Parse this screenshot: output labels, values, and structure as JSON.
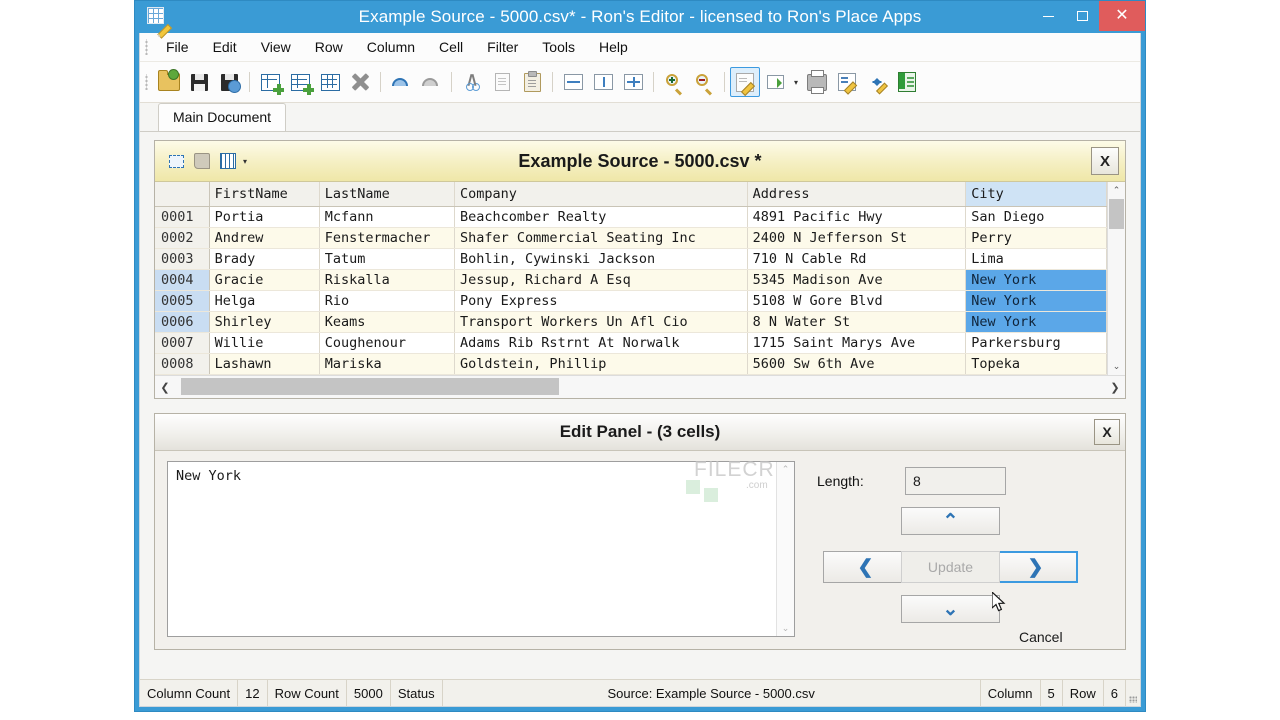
{
  "window": {
    "title": "Example Source - 5000.csv* - Ron's Editor - licensed to Ron's Place Apps",
    "app_icon": "grid-pencil-icon",
    "minimize": "minimize-icon",
    "maximize": "maximize-icon",
    "close": "close-icon",
    "accent": "#3a9bd5",
    "close_color": "#e05c5c"
  },
  "menu": {
    "items": [
      "File",
      "Edit",
      "View",
      "Row",
      "Column",
      "Cell",
      "Filter",
      "Tools",
      "Help"
    ]
  },
  "toolbar": {
    "items": [
      {
        "name": "open-file-icon"
      },
      {
        "name": "save-icon"
      },
      {
        "name": "save-as-icon"
      },
      {
        "name": "insert-column-icon"
      },
      {
        "name": "insert-row-icon"
      },
      {
        "name": "table-icon"
      },
      {
        "name": "delete-icon"
      },
      {
        "name": "undo-icon"
      },
      {
        "name": "redo-icon"
      },
      {
        "name": "cut-icon"
      },
      {
        "name": "copy-icon"
      },
      {
        "name": "paste-icon"
      },
      {
        "name": "fit-width-icon"
      },
      {
        "name": "fit-height-icon"
      },
      {
        "name": "fit-page-icon"
      },
      {
        "name": "zoom-in-icon"
      },
      {
        "name": "zoom-out-icon"
      },
      {
        "name": "edit-document-icon",
        "active": true
      },
      {
        "name": "export-icon",
        "caret": true
      },
      {
        "name": "print-icon"
      },
      {
        "name": "edit-schema-icon"
      },
      {
        "name": "sort-icon"
      },
      {
        "name": "excel-icon"
      }
    ]
  },
  "tabs": [
    {
      "label": "Main Document",
      "active": true
    }
  ],
  "grid_panel": {
    "title": "Example Source - 5000.csv *",
    "close_label": "X",
    "tools": [
      "select-region-icon",
      "stamp-icon",
      "columns-icon"
    ],
    "caret": "▾",
    "columns": [
      "",
      "FirstName",
      "LastName",
      "Company",
      "Address",
      "City"
    ],
    "selected_column": "City",
    "rows": [
      {
        "num": "0001",
        "first": "Portia",
        "last": "Mcfann",
        "company": "Beachcomber Realty",
        "address": "4891 Pacific Hwy",
        "city": "San Diego",
        "city_selected": false,
        "row_highlight": false
      },
      {
        "num": "0002",
        "first": "Andrew",
        "last": "Fenstermacher",
        "company": "Shafer Commercial Seating Inc",
        "address": "2400 N Jefferson St",
        "city": "Perry",
        "city_selected": false,
        "row_highlight": false
      },
      {
        "num": "0003",
        "first": "Brady",
        "last": "Tatum",
        "company": "Bohlin, Cywinski Jackson",
        "address": "710 N Cable Rd",
        "city": "Lima",
        "city_selected": false,
        "row_highlight": false
      },
      {
        "num": "0004",
        "first": "Gracie",
        "last": "Riskalla",
        "company": "Jessup, Richard A Esq",
        "address": "5345 Madison Ave",
        "city": "New York",
        "city_selected": true,
        "row_highlight": true
      },
      {
        "num": "0005",
        "first": "Helga",
        "last": "Rio",
        "company": "Pony Express",
        "address": "5108 W Gore Blvd",
        "city": "New York",
        "city_selected": true,
        "row_highlight": true
      },
      {
        "num": "0006",
        "first": "Shirley",
        "last": "Keams",
        "company": "Transport Workers Un Afl Cio",
        "address": "8 N Water St",
        "city": "New York",
        "city_selected": true,
        "row_highlight": true
      },
      {
        "num": "0007",
        "first": "Willie",
        "last": "Coughenour",
        "company": "Adams Rib Rstrnt At Norwalk",
        "address": "1715 Saint Marys Ave",
        "city": "Parkersburg",
        "city_selected": false,
        "row_highlight": false
      },
      {
        "num": "0008",
        "first": "Lashawn",
        "last": "Mariska",
        "company": "Goldstein, Phillip",
        "address": "5600 Sw 6th Ave",
        "city": "Topeka",
        "city_selected": false,
        "row_highlight": false
      }
    ],
    "selection_color": "#5ba7e8"
  },
  "edit_panel": {
    "title": "Edit Panel - (3 cells)",
    "close_label": "X",
    "value": "New York",
    "length_label": "Length:",
    "length_value": "8",
    "buttons": {
      "up": "▲",
      "down": "▼",
      "prev": "❮",
      "next": "❯",
      "update": "Update",
      "update_disabled": true,
      "cancel": "Cancel"
    }
  },
  "watermark": {
    "big": "FILECR",
    "small": ".com"
  },
  "statusbar": {
    "column_count_label": "Column Count",
    "column_count_value": "12",
    "row_count_label": "Row Count",
    "row_count_value": "5000",
    "status_label": "Status",
    "source": "Source: Example Source - 5000.csv",
    "column_label": "Column",
    "column_value": "5",
    "row_label": "Row",
    "row_value": "6"
  }
}
